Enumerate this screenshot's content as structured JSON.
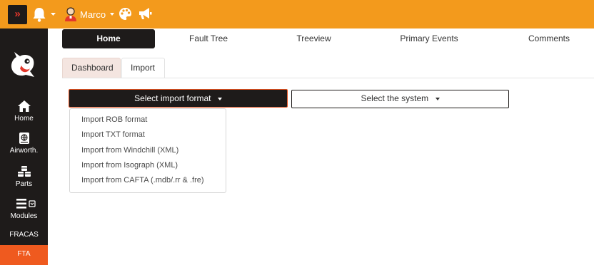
{
  "topbar": {
    "collapse_label": "»",
    "user_name": "Marco",
    "icons": [
      "double-chevron-right-icon",
      "bell-icon",
      "user-avatar-icon",
      "palette-icon",
      "megaphone-icon"
    ]
  },
  "sidebar": {
    "items": [
      {
        "label": "Home",
        "icon": "home-icon"
      },
      {
        "label": "Airworth.",
        "icon": "globe-book-icon"
      },
      {
        "label": "Parts",
        "icon": "cubes-icon"
      },
      {
        "label": "Modules",
        "icon": "bars-icon"
      },
      {
        "label": "FRACAS"
      },
      {
        "label": "FTA"
      }
    ]
  },
  "nav_tabs": [
    "Home",
    "Fault Tree",
    "Treeview",
    "Primary Events",
    "Comments"
  ],
  "sub_tabs": [
    "Dashboard",
    "Import"
  ],
  "import_format_button": "Select import format",
  "system_button": "Select the system",
  "import_options": [
    "Import ROB format",
    "Import TXT format",
    "Import from Windchill (XML)",
    "Import from Isograph (XML)",
    "Import from CAFTA (.mdb/.rr & .fre)"
  ],
  "colors": {
    "topbar": "#f39a1c",
    "sidebar": "#1e1b1a",
    "accent": "#ef5a1f",
    "button_border": "#e2501f"
  }
}
